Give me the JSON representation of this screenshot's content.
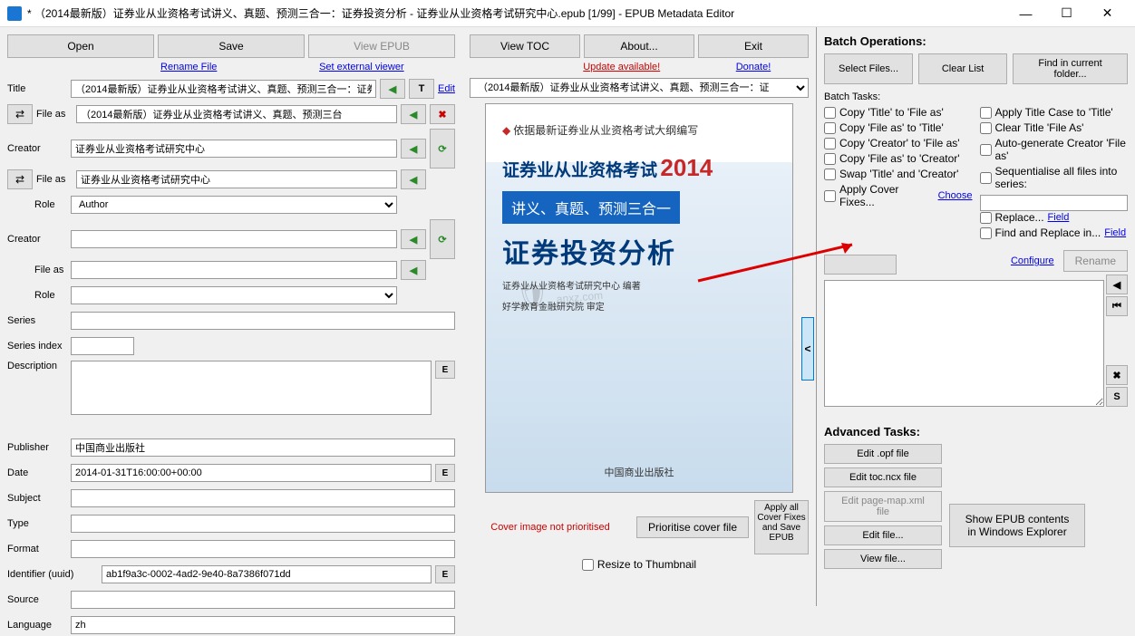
{
  "window": {
    "title": "* （2014最新版）证券业从业资格考试讲义、真题、预测三合一：证券投资分析 - 证券业从业资格考试研究中心.epub [1/99] - EPUB Metadata Editor"
  },
  "toolbar": {
    "open": "Open",
    "save": "Save",
    "view_epub": "View EPUB",
    "view_toc": "View TOC",
    "about": "About...",
    "exit": "Exit",
    "rename_file": "Rename File",
    "set_viewer": "Set external viewer",
    "update": "Update available!",
    "donate": "Donate!"
  },
  "fields": {
    "title_label": "Title",
    "title": "（2014最新版）证券业从业资格考试讲义、真题、预测三合一：证券",
    "file_as_label": "File as",
    "file_as_1": "（2014最新版）证券业从业资格考试讲义、真题、预测三台",
    "creator_label": "Creator",
    "creator": "证券业从业资格考试研究中心",
    "file_as_2": "证券业从业资格考试研究中心",
    "role_label": "Role",
    "role": "Author",
    "creator2": "",
    "file_as_3": "",
    "role2": "",
    "series_label": "Series",
    "series": "",
    "series_index_label": "Series index",
    "series_index": "",
    "description_label": "Description",
    "description": "",
    "publisher_label": "Publisher",
    "publisher": "中国商业出版社",
    "date_label": "Date",
    "date": "2014-01-31T16:00:00+00:00",
    "subject_label": "Subject",
    "subject": "",
    "type_label": "Type",
    "type": "",
    "format_label": "Format",
    "format": "",
    "identifier_label": "Identifier (uuid)",
    "identifier": "ab1f9a3c-0002-4ad2-9e40-8a7386f071dd",
    "source_label": "Source",
    "source": "",
    "language_label": "Language",
    "language": "zh",
    "edit_link": "Edit",
    "t_btn": "T",
    "e_btn": "E"
  },
  "cover": {
    "dropdown": "（2014最新版）证券业从业资格考试讲义、真题、预测三合一：证",
    "top_text": "依据最新证券业从业资格考试大纲编写",
    "title1": "证券业从业资格考试",
    "year": "2014",
    "sub": "讲义、真题、预测三合一",
    "big": "证券投资分析",
    "author_line1": "证券业从业资格考试研究中心 编著",
    "author_line2": "好学教育金融研究院 审定",
    "publisher_line": "中国商业出版社",
    "watermark": "anxz.com",
    "msg": "Cover image not prioritised",
    "prioritise": "Prioritise cover file",
    "resize": "Resize to Thumbnail",
    "apply_all": "Apply all Cover Fixes and Save EPUB",
    "nav_left": "<"
  },
  "batch": {
    "header": "Batch Operations:",
    "select_files": "Select Files...",
    "clear_list": "Clear List",
    "find_folder": "Find in current folder...",
    "tasks_label": "Batch Tasks:",
    "c1_1": "Copy 'Title' to 'File as'",
    "c1_2": "Copy 'File as' to 'Title'",
    "c1_3": "Copy 'Creator' to 'File as'",
    "c1_4": "Copy 'File as' to 'Creator'",
    "c1_5": "Swap 'Title' and 'Creator'",
    "c1_6": "Apply Cover Fixes...",
    "c1_6_link": "Choose",
    "c2_1": "Apply Title Case to 'Title'",
    "c2_2": "Clear Title 'File As'",
    "c2_3": "Auto-generate Creator 'File as'",
    "c2_4": "Sequentialise all files into series:",
    "c2_5": "Replace...",
    "c2_5_link": "Field",
    "c2_6": "Find and Replace in...",
    "c2_6_link": "Field",
    "configure": "Configure",
    "rename": "Rename",
    "s_btn": "S"
  },
  "advanced": {
    "header": "Advanced Tasks:",
    "edit_opf": "Edit .opf file",
    "edit_toc": "Edit toc.ncx file",
    "edit_pagemap": "Edit page-map.xml file",
    "edit_file": "Edit file...",
    "view_file": "View file...",
    "show_explorer": "Show EPUB contents in Windows Explorer"
  }
}
